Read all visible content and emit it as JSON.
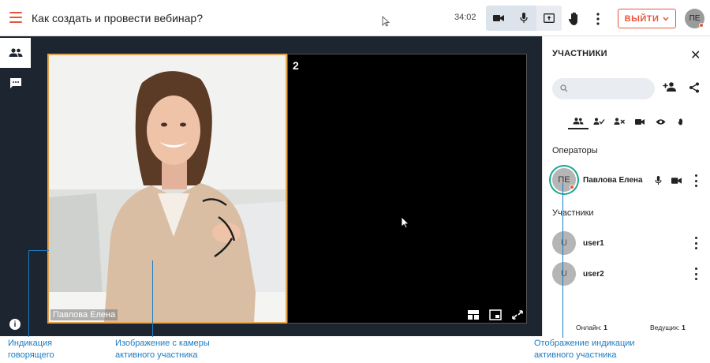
{
  "header": {
    "title": "Как создать и провести вебинар?",
    "timer": "34:02",
    "exit_label": "ВЫЙТИ",
    "avatar_initials": "ПЕ"
  },
  "video": {
    "speaker_name": "Павлова Елена",
    "tile2_number": "2"
  },
  "panel": {
    "title": "УЧАСТНИКИ",
    "search_placeholder": "",
    "operators_label": "Операторы",
    "participants_label": "Участники",
    "operators": [
      {
        "initials": "ПЕ",
        "name": "Павлова Елена"
      }
    ],
    "participants": [
      {
        "initials": "U",
        "name": "user1"
      },
      {
        "initials": "U",
        "name": "user2"
      }
    ],
    "footer_online_label": "Онлайн:",
    "footer_online_value": "1",
    "footer_hosts_label": "Ведущих:",
    "footer_hosts_value": "1"
  },
  "annotations": {
    "speaker_indicator_1": "Индикация",
    "speaker_indicator_2": "говорящего",
    "camera_image_1": "Изображение с камеры",
    "camera_image_2": "активного участника",
    "active_display_1": "Отображение индикации",
    "active_display_2": "активного участника"
  },
  "colors": {
    "accent": "#e8553b",
    "speaking_ring": "#16a58e",
    "annotation": "#1b7cc2",
    "dark_bg": "#1d2530",
    "active_tile_border": "#e5a34f"
  }
}
